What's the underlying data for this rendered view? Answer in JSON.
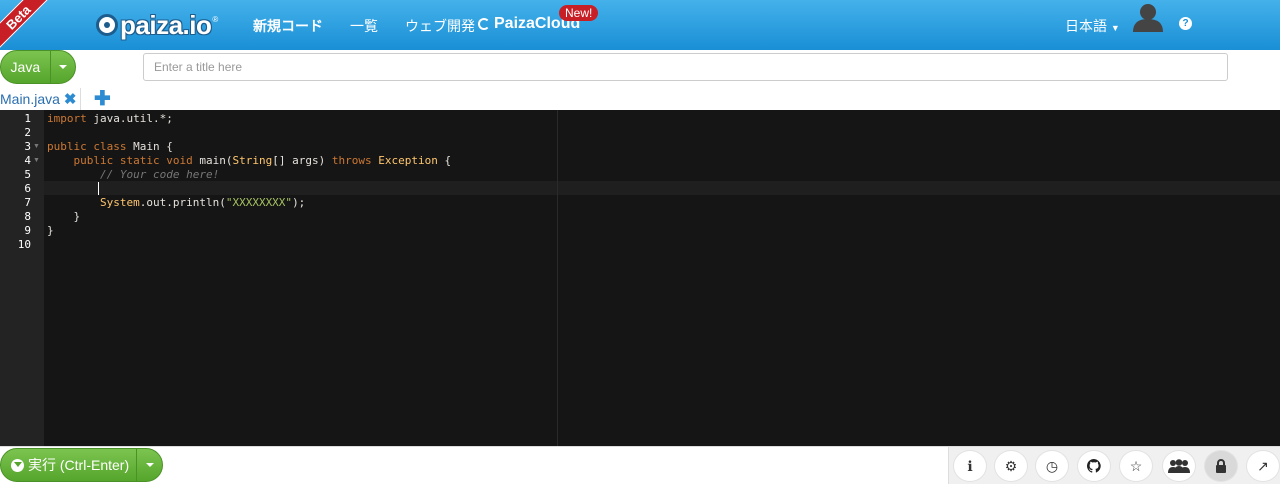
{
  "header": {
    "beta": "Beta",
    "logo": "paiza.io",
    "logo_mark": "®",
    "nav_new_code": "新規コード",
    "nav_list": "一覧",
    "nav_web_dev": "ウェブ開発",
    "paizacloud": "PaizaCloud",
    "new_badge": "New!",
    "language": "日本語",
    "help": "?"
  },
  "toolbar": {
    "language_button": "Java",
    "title_placeholder": "Enter a title here"
  },
  "tabs": {
    "file_name": "Main.java",
    "close": "✖",
    "add": "✚"
  },
  "editor": {
    "line_numbers": [
      "1",
      "2",
      "3",
      "4",
      "5",
      "6",
      "7",
      "8",
      "9",
      "10"
    ]
  },
  "bottom": {
    "run_label": "実行 (Ctrl-Enter)"
  },
  "tools": [
    {
      "icon": "info-icon",
      "glyph": "ℹ"
    },
    {
      "icon": "gear-icon",
      "glyph": "⚙"
    },
    {
      "icon": "history-icon",
      "glyph": "◷"
    },
    {
      "icon": "github-icon",
      "glyph": "●"
    },
    {
      "icon": "star-icon",
      "glyph": "☆"
    },
    {
      "icon": "users-icon",
      "glyph": "👥"
    },
    {
      "icon": "lock-icon",
      "glyph": "🔒"
    },
    {
      "icon": "share-icon",
      "glyph": "↗"
    }
  ],
  "colors": {
    "header_blue": "#1a8fd6",
    "run_green": "#55a52c",
    "editor_bg": "#151515"
  }
}
